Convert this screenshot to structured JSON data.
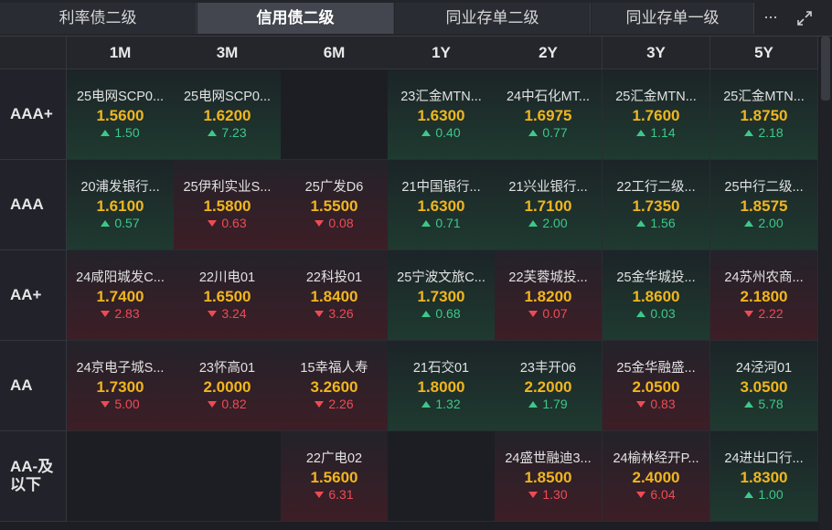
{
  "tabs": [
    {
      "label": "利率债二级",
      "active": false
    },
    {
      "label": "信用债二级",
      "active": true
    },
    {
      "label": "同业存单二级",
      "active": false
    },
    {
      "label": "同业存单一级",
      "active": false
    }
  ],
  "more_label": "···",
  "icons": {
    "more": "more-icon",
    "expand": "expand-icon"
  },
  "colors": {
    "rate": "#f0b61e",
    "up": "#3dc88a",
    "down": "#ef4b55"
  },
  "columns": [
    "1M",
    "3M",
    "6M",
    "1Y",
    "2Y",
    "3Y",
    "5Y"
  ],
  "rows": [
    {
      "label": "AAA+",
      "cells": [
        {
          "name": "25电网SCP0...",
          "rate": "1.5600",
          "change": "1.50",
          "dir": "up"
        },
        {
          "name": "25电网SCP0...",
          "rate": "1.6200",
          "change": "7.23",
          "dir": "up"
        },
        null,
        {
          "name": "23汇金MTN...",
          "rate": "1.6300",
          "change": "0.40",
          "dir": "up"
        },
        {
          "name": "24中石化MT...",
          "rate": "1.6975",
          "change": "0.77",
          "dir": "up"
        },
        {
          "name": "25汇金MTN...",
          "rate": "1.7600",
          "change": "1.14",
          "dir": "up"
        },
        {
          "name": "25汇金MTN...",
          "rate": "1.8750",
          "change": "2.18",
          "dir": "up"
        }
      ]
    },
    {
      "label": "AAA",
      "cells": [
        {
          "name": "20浦发银行...",
          "rate": "1.6100",
          "change": "0.57",
          "dir": "up"
        },
        {
          "name": "25伊利实业S...",
          "rate": "1.5800",
          "change": "0.63",
          "dir": "down"
        },
        {
          "name": "25广发D6",
          "rate": "1.5500",
          "change": "0.08",
          "dir": "down"
        },
        {
          "name": "21中国银行...",
          "rate": "1.6300",
          "change": "0.71",
          "dir": "up"
        },
        {
          "name": "21兴业银行...",
          "rate": "1.7100",
          "change": "2.00",
          "dir": "up"
        },
        {
          "name": "22工行二级...",
          "rate": "1.7350",
          "change": "1.56",
          "dir": "up"
        },
        {
          "name": "25中行二级...",
          "rate": "1.8575",
          "change": "2.00",
          "dir": "up"
        }
      ]
    },
    {
      "label": "AA+",
      "cells": [
        {
          "name": "24咸阳城发C...",
          "rate": "1.7400",
          "change": "2.83",
          "dir": "down"
        },
        {
          "name": "22川电01",
          "rate": "1.6500",
          "change": "3.24",
          "dir": "down"
        },
        {
          "name": "22科投01",
          "rate": "1.8400",
          "change": "3.26",
          "dir": "down"
        },
        {
          "name": "25宁波文旅C...",
          "rate": "1.7300",
          "change": "0.68",
          "dir": "up"
        },
        {
          "name": "22芙蓉城投...",
          "rate": "1.8200",
          "change": "0.07",
          "dir": "down"
        },
        {
          "name": "25金华城投...",
          "rate": "1.8600",
          "change": "0.03",
          "dir": "up"
        },
        {
          "name": "24苏州农商...",
          "rate": "2.1800",
          "change": "2.22",
          "dir": "down"
        }
      ]
    },
    {
      "label": "AA",
      "cells": [
        {
          "name": "24京电子城S...",
          "rate": "1.7300",
          "change": "5.00",
          "dir": "down"
        },
        {
          "name": "23怀高01",
          "rate": "2.0000",
          "change": "0.82",
          "dir": "down"
        },
        {
          "name": "15幸福人寿",
          "rate": "3.2600",
          "change": "2.26",
          "dir": "down"
        },
        {
          "name": "21石交01",
          "rate": "1.8000",
          "change": "1.32",
          "dir": "up"
        },
        {
          "name": "23丰开06",
          "rate": "2.2000",
          "change": "1.79",
          "dir": "up"
        },
        {
          "name": "25金华融盛...",
          "rate": "2.0500",
          "change": "0.83",
          "dir": "down"
        },
        {
          "name": "24泾河01",
          "rate": "3.0500",
          "change": "5.78",
          "dir": "up"
        }
      ]
    },
    {
      "label": "AA-及以下",
      "label_lines": [
        "AA-及",
        "以下"
      ],
      "cells": [
        null,
        null,
        {
          "name": "22广电02",
          "rate": "1.5600",
          "change": "6.31",
          "dir": "down"
        },
        null,
        {
          "name": "24盛世融迪3...",
          "rate": "1.8500",
          "change": "1.30",
          "dir": "down"
        },
        {
          "name": "24榆林经开P...",
          "rate": "2.4000",
          "change": "6.04",
          "dir": "down"
        },
        {
          "name": "24进出口行...",
          "rate": "1.8300",
          "change": "1.00",
          "dir": "up"
        }
      ]
    }
  ]
}
